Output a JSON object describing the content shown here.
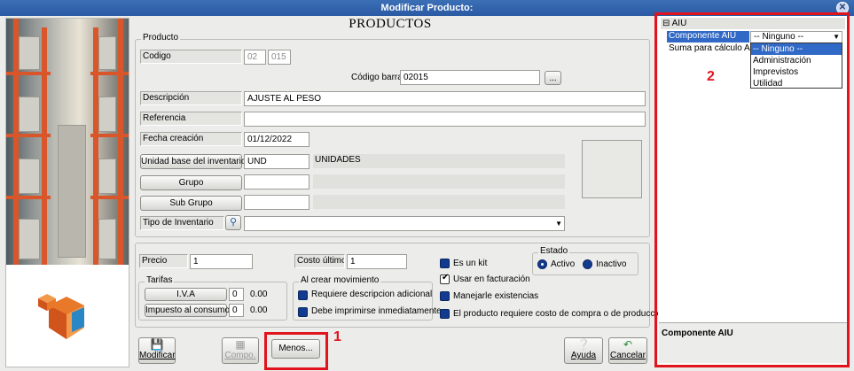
{
  "window": {
    "title": "Modificar Producto:",
    "close_icon": "close-icon"
  },
  "form_title": "PRODUCTOS",
  "producto": {
    "legend": "Producto",
    "codigo_label": "Codigo",
    "codigo_prefix": "02",
    "codigo_value": "015",
    "codigo_barras_label": "Código barras",
    "codigo_barras_value": "02015",
    "browse_label": "...",
    "descripcion_label": "Descripción",
    "descripcion_value": "AJUSTE AL PESO",
    "referencia_label": "Referencia",
    "referencia_value": "",
    "fecha_label": "Fecha creación",
    "fecha_value": "01/12/2022",
    "unidad_button": "Unidad base del inventario",
    "unidad_code": "UND",
    "unidad_name": "UNIDADES",
    "grupo_button": "Grupo",
    "grupo_value": "",
    "subgrupo_button": "Sub Grupo",
    "subgrupo_value": "",
    "tipo_label": "Tipo de Inventario",
    "tipo_value": ""
  },
  "precio": {
    "precio_label": "Precio",
    "precio_value": "1",
    "costo_label": "Costo último",
    "costo_value": "1"
  },
  "tarifas": {
    "legend": "Tarifas",
    "iva_button": "I.V.A",
    "iva_code": "0",
    "iva_value": "0.00",
    "consumo_button": "Impuesto al consumo",
    "consumo_code": "0",
    "consumo_value": "0.00"
  },
  "movimiento": {
    "legend": "Al crear movimiento",
    "requiere_desc": "Requiere descripcion adicional",
    "debe_imprimir": "Debe imprimirse inmediatamente"
  },
  "options": {
    "es_kit": "Es un kit",
    "usar_facturacion": "Usar en facturación",
    "manejar_existencias": "Manejarle existencias",
    "requiere_costo": "El producto requiere costo de compra o de producción"
  },
  "estado": {
    "legend": "Estado",
    "activo": "Activo",
    "inactivo": "Inactivo"
  },
  "toolbar": {
    "modificar": "Modificar",
    "compo": "Compo.",
    "menos": "Menos...",
    "ayuda": "Ayuda",
    "cancelar": "Cancelar"
  },
  "annotations": {
    "marker_1": "1",
    "marker_2": "2",
    "color": "#e1131d"
  },
  "aiu_panel": {
    "header": "AIU",
    "rows": [
      {
        "label": "Componente AIU",
        "value": "-- Ninguno --"
      },
      {
        "label": "Suma para cálculo AIU",
        "value": ""
      }
    ],
    "dropdown_options": [
      "-- Ninguno --",
      "Administración",
      "Imprevistos",
      "Utilidad"
    ],
    "description_title": "Componente AIU"
  }
}
